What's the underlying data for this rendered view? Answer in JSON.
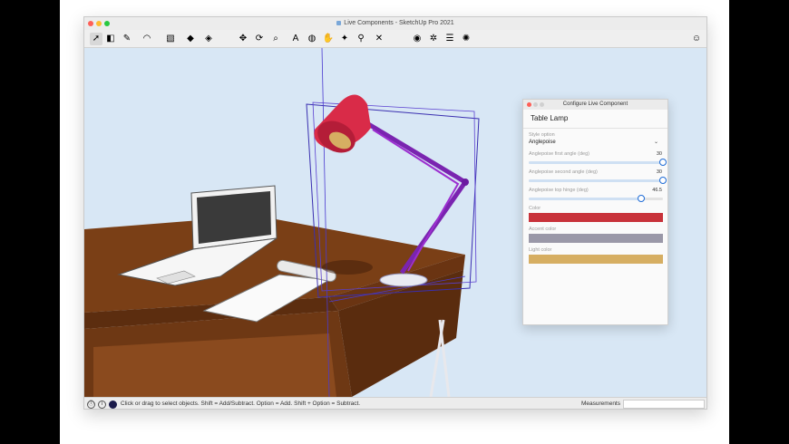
{
  "window": {
    "title": "Live Components - SketchUp Pro 2021"
  },
  "toolbar": {
    "tools": [
      {
        "name": "select-tool-icon",
        "glyph": "➚"
      },
      {
        "name": "eraser-tool-icon",
        "glyph": "◧"
      },
      {
        "name": "line-tool-icon",
        "glyph": "✎"
      },
      {
        "name": "arc-tool-icon",
        "glyph": "◠"
      },
      {
        "name": "shape-tool-icon",
        "glyph": "▧"
      },
      {
        "name": "push-pull-tool-icon",
        "glyph": "◆"
      },
      {
        "name": "paint-bucket-tool-icon",
        "glyph": "◈"
      },
      {
        "name": "move-tool-icon",
        "glyph": "✥"
      },
      {
        "name": "rotate-tool-icon",
        "glyph": "⟳"
      },
      {
        "name": "tape-measure-tool-icon",
        "glyph": "⌕"
      },
      {
        "name": "text-tool-icon",
        "glyph": "A"
      },
      {
        "name": "orbit-tool-icon",
        "glyph": "◍"
      },
      {
        "name": "pan-tool-icon",
        "glyph": "✋"
      },
      {
        "name": "walk-tool-icon",
        "glyph": "✦"
      },
      {
        "name": "zoom-tool-icon",
        "glyph": "⚲"
      },
      {
        "name": "zoom-extents-tool-icon",
        "glyph": "✕"
      },
      {
        "name": "warehouse-icon",
        "glyph": "◉"
      },
      {
        "name": "extension-warehouse-icon",
        "glyph": "✲"
      },
      {
        "name": "layers-icon",
        "glyph": "☰"
      },
      {
        "name": "extension-manager-icon",
        "glyph": "✺"
      }
    ],
    "account_icon": "user-icon"
  },
  "panel": {
    "title": "Configure Live Component",
    "heading": "Table Lamp",
    "style_option_label": "Style option",
    "style_option_value": "Anglepoise",
    "sliders": [
      {
        "label": "Anglepoise first angle (deg)",
        "value": "30",
        "fraction": 1.0
      },
      {
        "label": "Anglepoise second angle (deg)",
        "value": "30",
        "fraction": 1.0
      },
      {
        "label": "Anglepoise top hinge (deg)",
        "value": "46.5",
        "fraction": 0.84
      }
    ],
    "colors": [
      {
        "label": "Color",
        "hex": "#c8323a"
      },
      {
        "label": "Accent color",
        "hex": "#9a98a8"
      },
      {
        "label": "Light color",
        "hex": "#d6ae62"
      }
    ]
  },
  "status": {
    "text": "Click or drag to select objects. Shift = Add/Subtract. Option = Add. Shift + Option = Subtract.",
    "measurements_label": "Measurements",
    "measurements_value": ""
  }
}
